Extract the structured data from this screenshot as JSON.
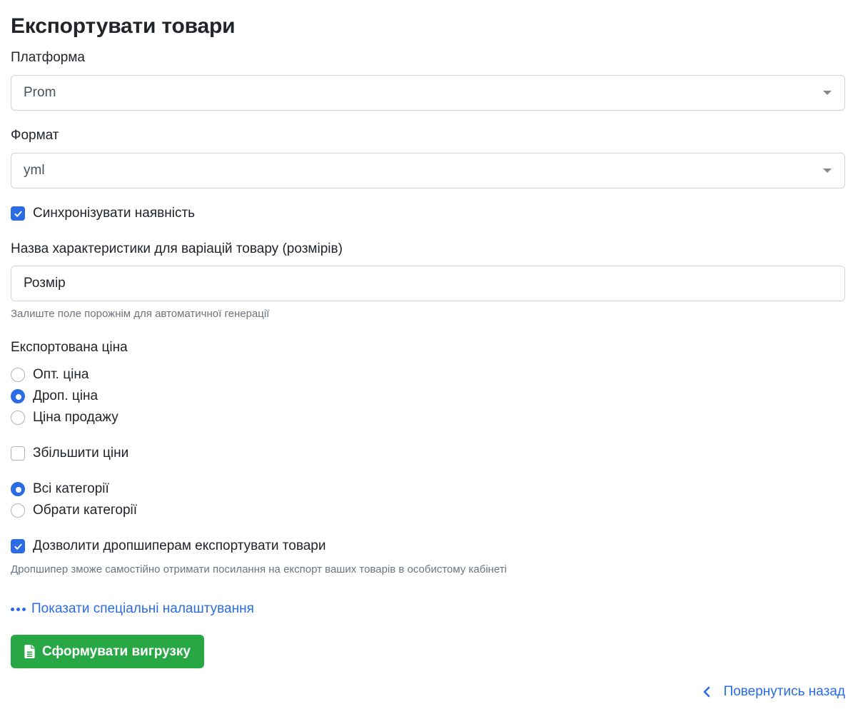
{
  "page": {
    "title": "Експортувати товари"
  },
  "platform": {
    "label": "Платформа",
    "value": "Prom"
  },
  "format": {
    "label": "Формат",
    "value": "yml"
  },
  "sync_stock": {
    "label": "Синхронізувати наявність",
    "checked": true
  },
  "variation_name": {
    "label": "Назва характеристики для варіацій товару (розмірів)",
    "value": "Розмір",
    "hint": "Залиште поле порожнім для автоматичної генерації"
  },
  "export_price": {
    "label": "Експортована ціна",
    "options": [
      {
        "label": "Опт. ціна",
        "selected": false
      },
      {
        "label": "Дроп. ціна",
        "selected": true
      },
      {
        "label": "Ціна продажу",
        "selected": false
      }
    ]
  },
  "increase_prices": {
    "label": "Збільшити ціни",
    "checked": false
  },
  "categories": {
    "options": [
      {
        "label": "Всі категорії",
        "selected": true
      },
      {
        "label": "Обрати категорії",
        "selected": false
      }
    ]
  },
  "allow_dropshippers": {
    "label": "Дозволити дропшиперам експортувати товари",
    "checked": true,
    "hint": "Дропшипер зможе самостійно отримати посилання на експорт ваших товарів в особистому кабінеті"
  },
  "special_settings": {
    "label": "Показати спеціальні налаштування"
  },
  "generate_button": {
    "label": "Сформувати вигрузку"
  },
  "back_link": {
    "label": "Повернутись назад"
  },
  "colors": {
    "accent": "#2a6be6",
    "success": "#28a745",
    "muted": "#6c757d"
  }
}
